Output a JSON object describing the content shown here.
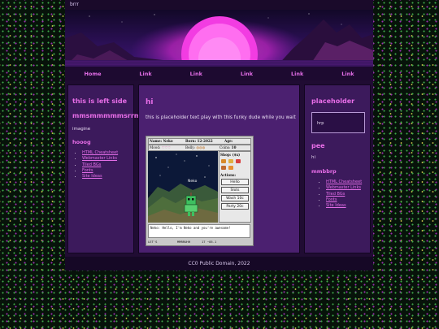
{
  "window": {
    "title": "brrr"
  },
  "nav": {
    "items": [
      "Home",
      "Link",
      "Link",
      "Link",
      "Link",
      "Link"
    ]
  },
  "left": {
    "heading": "this is left side",
    "subheading": "mmsmmmmmsrrm",
    "text": "imagine",
    "links_heading": "hooog",
    "links": [
      "HTML Cheatsheet",
      "Webmaster Links",
      "Tiled BGs",
      "Fonts",
      "Site Ideas"
    ]
  },
  "main": {
    "heading": "hi",
    "text": "this is placeholder text play with this funky dude while you wait"
  },
  "game": {
    "name_label": "Name:",
    "name_value": "Neko",
    "born_label": "Born:",
    "born_value": "12-2022",
    "age_label": "Age:",
    "mood_label": "Mood:",
    "belly_label": "Belly:",
    "coins_label": "Coins:",
    "coins_value": "10",
    "shop_label": "Shop: ($x)",
    "actions_label": "Actions:",
    "pet_name": "Neko",
    "buttons": [
      "Hello",
      "Slots",
      "Wash 10c",
      "Party 20c"
    ],
    "dialog": "Neko: Hello, I'm Neko and you're awesome!",
    "status": [
      "LET'S",
      "MMRRUHH",
      "17 ~05.1"
    ]
  },
  "right": {
    "heading": "placeholder",
    "search_value": "hrp",
    "section_heading": "pee",
    "section_text": "hi",
    "links_heading": "mmbbrp",
    "links": [
      "HTML Cheatsheet",
      "Webmaster Links",
      "Tiled BGs",
      "Fonts",
      "Site Ideas"
    ]
  },
  "footer": {
    "text": "CC0 Public Domain, 2022"
  },
  "colors": {
    "accent": "#e86ee8",
    "panel": "#3c1a5c",
    "background": "#07130a"
  }
}
